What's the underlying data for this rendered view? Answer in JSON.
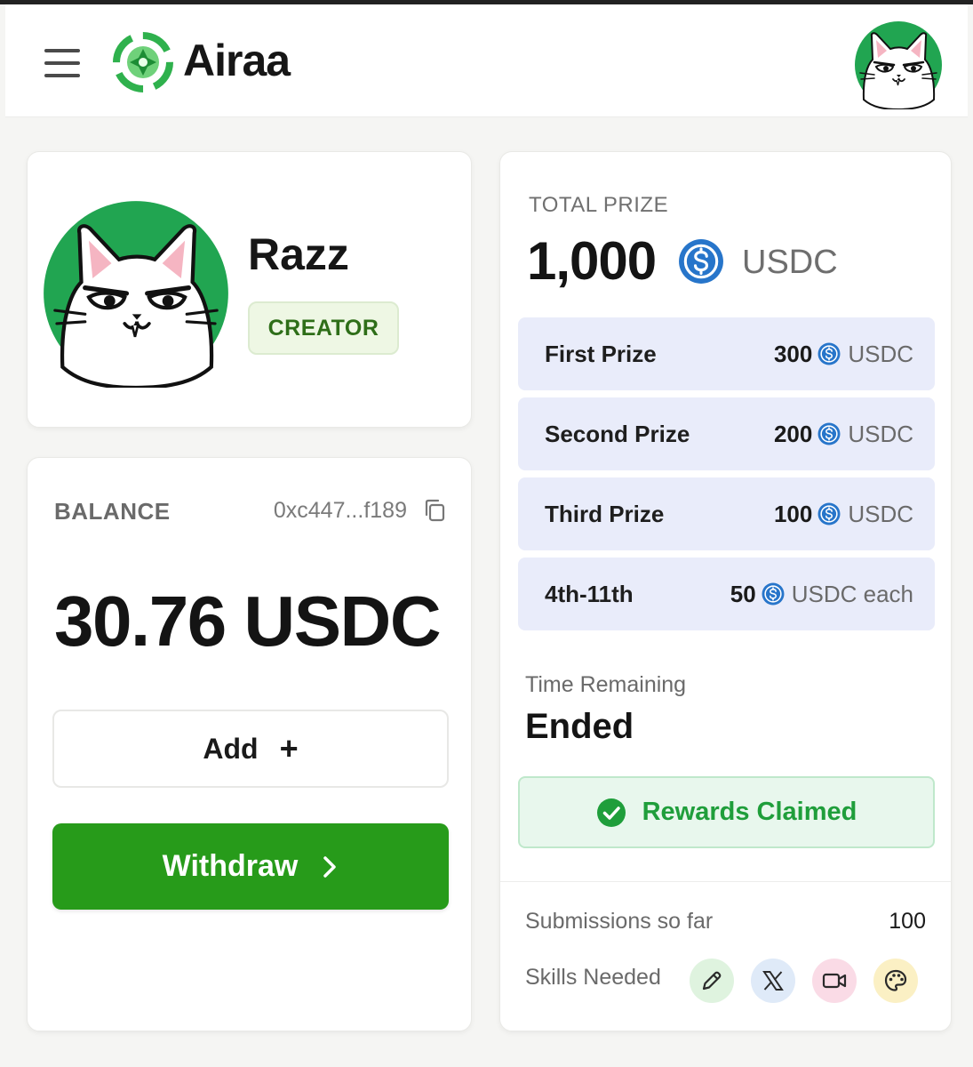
{
  "header": {
    "brand": "Airaa",
    "menu_icon": "hamburger-menu-icon",
    "logo_icon": "airaa-logo-icon",
    "avatar_icon": "cat-avatar-icon"
  },
  "profile": {
    "name": "Razz",
    "badge": "CREATOR"
  },
  "balance": {
    "label": "BALANCE",
    "address": "0xc447...f189",
    "amount": "30.76 USDC",
    "add_label": "Add",
    "add_icon": "+",
    "withdraw_label": "Withdraw",
    "withdraw_icon": "chevron-right-icon"
  },
  "prize": {
    "total_label": "TOTAL PRIZE",
    "total_amount": "1,000",
    "total_unit": "USDC",
    "tiers": [
      {
        "rank": "First Prize",
        "value": "300",
        "unit": "USDC"
      },
      {
        "rank": "Second Prize",
        "value": "200",
        "unit": "USDC"
      },
      {
        "rank": "Third Prize",
        "value": "100",
        "unit": "USDC"
      },
      {
        "rank": "4th-11th",
        "value": "50",
        "unit": "USDC each"
      }
    ],
    "time_label": "Time Remaining",
    "time_value": "Ended",
    "rewards_status": "Rewards Claimed",
    "submissions_label": "Submissions so far",
    "submissions_value": "100",
    "skills_label": "Skills Needed",
    "skills": [
      {
        "icon": "pencil-icon",
        "bg": "#dff3df"
      },
      {
        "icon": "x-logo-icon",
        "bg": "#dfeaf8"
      },
      {
        "icon": "video-camera-icon",
        "bg": "#fadbe6"
      },
      {
        "icon": "palette-icon",
        "bg": "#fbf0c4"
      }
    ]
  },
  "colors": {
    "accent_green": "#279b1a",
    "usdc_blue": "#2775ca",
    "claimed_green": "#1f9e3b",
    "prize_row_bg": "#e9ecfa"
  }
}
